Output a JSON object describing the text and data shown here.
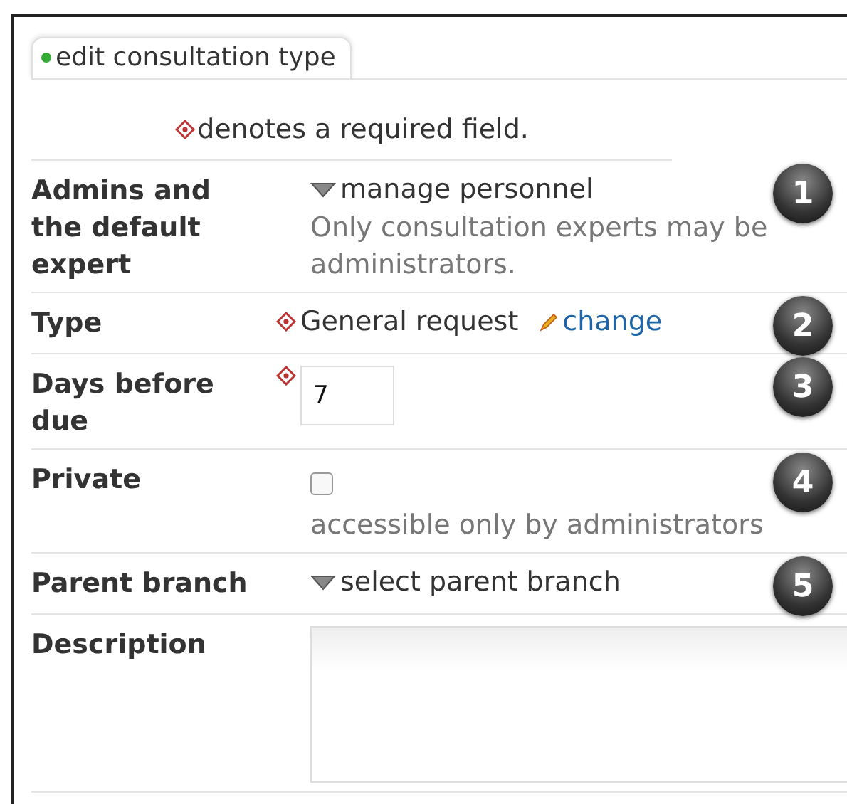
{
  "tab": {
    "label": "edit consultation type",
    "selected": true
  },
  "required_note": "denotes a required field.",
  "rows": [
    {
      "kind": "dropdown",
      "label": "Admins and the default expert",
      "value": "manage personnel",
      "hint": "Only consultation experts may be administrators.",
      "callout": "1"
    },
    {
      "kind": "fixed",
      "label": "Type",
      "required": true,
      "value": "General request",
      "link": "change",
      "callout": "2"
    },
    {
      "kind": "number",
      "label": "Days before due",
      "required": true,
      "value": "7",
      "callout": "3"
    },
    {
      "kind": "checkbox",
      "label": "Private",
      "checked": false,
      "hint": "accessible only by administrators",
      "callout": "4"
    },
    {
      "kind": "dropdown",
      "label": "Parent branch",
      "value": "select parent branch",
      "callout": "5"
    },
    {
      "kind": "textarea",
      "label": "Description"
    }
  ]
}
